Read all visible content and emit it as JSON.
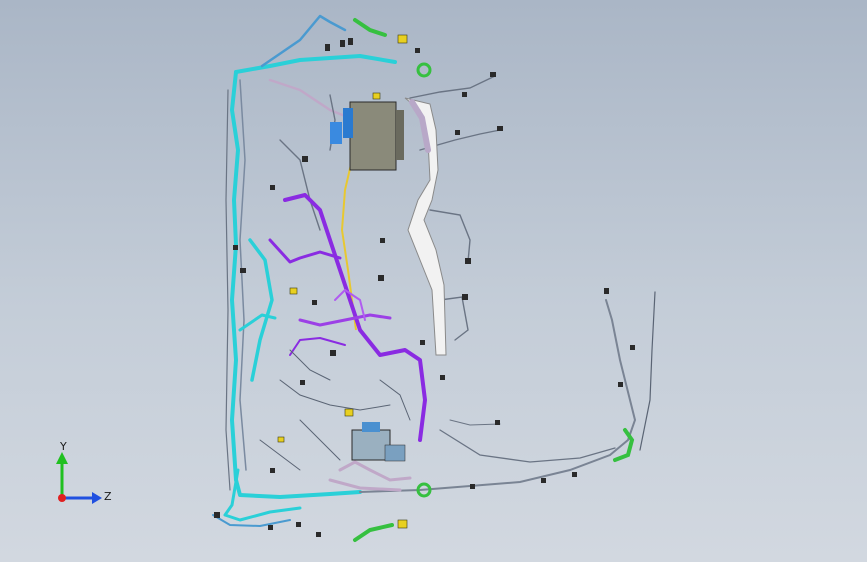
{
  "viewport": {
    "background_top": "#aab6c6",
    "background_bottom": "#d2d8e0"
  },
  "model": {
    "description_colors": {
      "cyan_harness": "#2ad0d8",
      "purple_harness": "#8a2be2",
      "lavender_harness": "#c0a8c8",
      "green_connector": "#36c040",
      "yellow_connector": "#e8d020",
      "white_duct": "#f2f2f2",
      "ecu_box": "#8a8a7a",
      "wire_grey": "#6a7484"
    }
  },
  "triad": {
    "y_label": "Y",
    "z_label": "Z",
    "y_color": "#20c020",
    "z_color": "#2050e0",
    "x_color": "#e02020"
  }
}
